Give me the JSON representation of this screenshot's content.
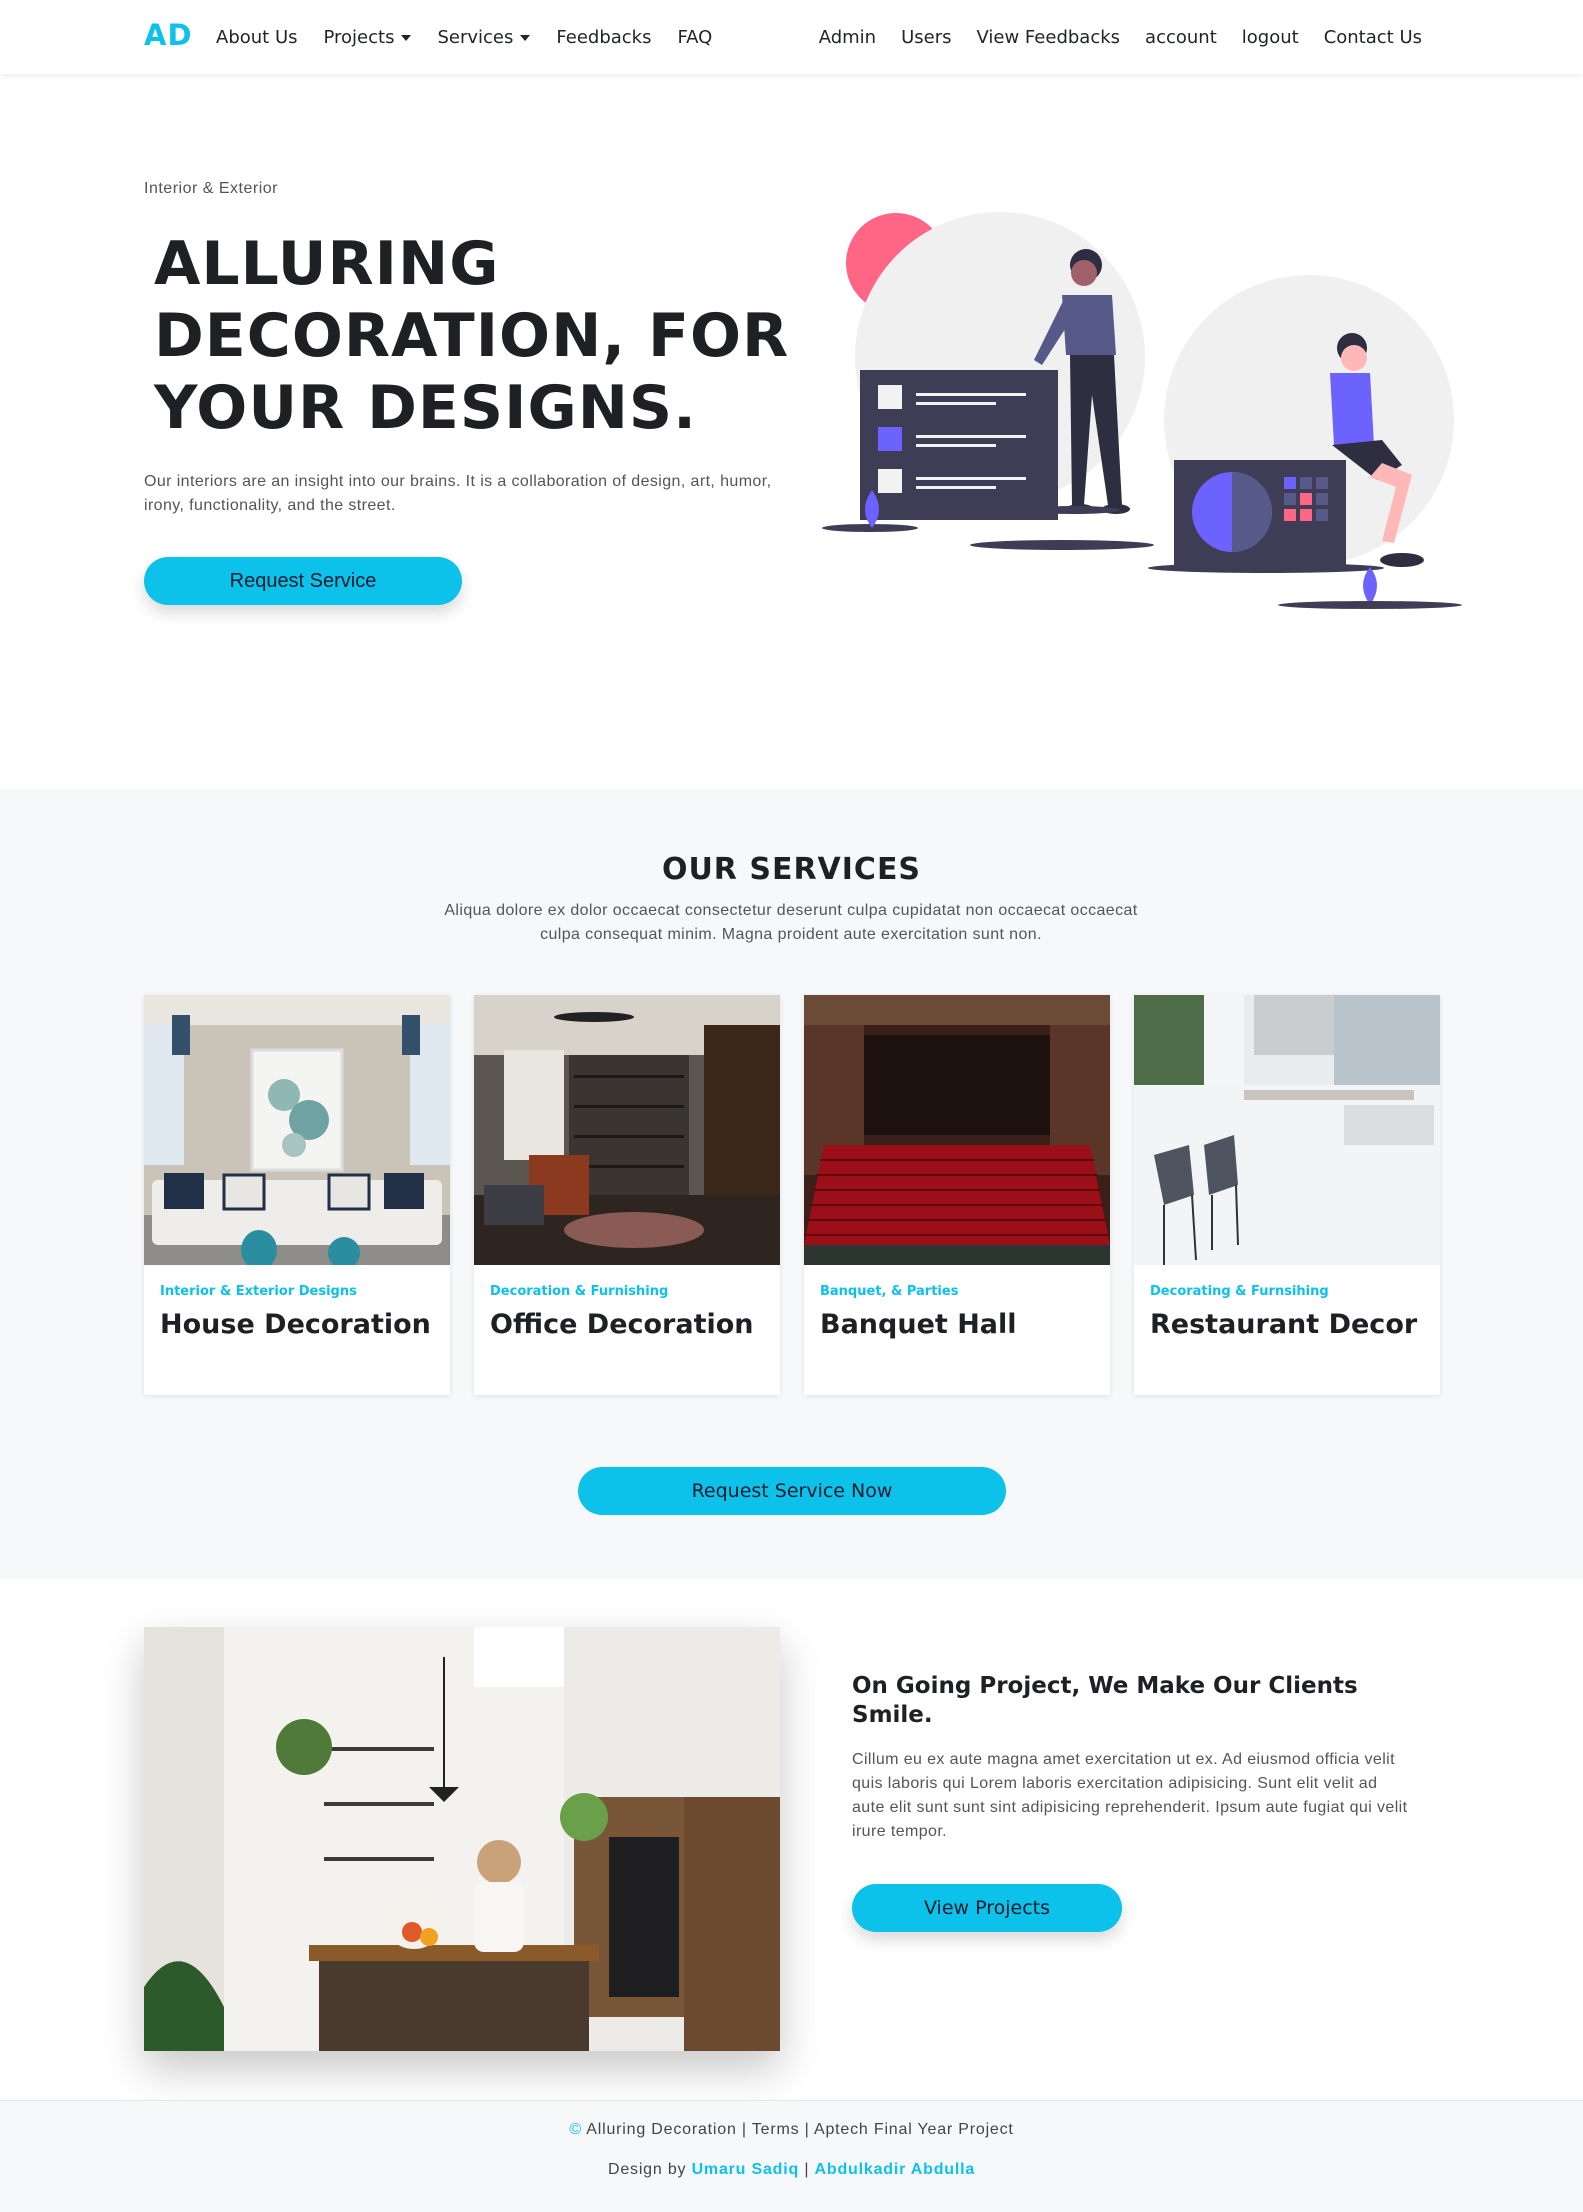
{
  "nav": {
    "brand": "AD",
    "left": [
      {
        "label": "About Us",
        "dropdown": false
      },
      {
        "label": "Projects",
        "dropdown": true
      },
      {
        "label": "Services",
        "dropdown": true
      },
      {
        "label": "Feedbacks",
        "dropdown": false
      },
      {
        "label": "FAQ",
        "dropdown": false
      }
    ],
    "right": [
      "Admin",
      "Users",
      "View Feedbacks",
      "account",
      "logout",
      "Contact Us"
    ]
  },
  "hero": {
    "eyebrow": "Interior & Exterior",
    "title_lines": [
      "ALLURING",
      "DECORATION, FOR",
      "YOUR DESIGNS."
    ],
    "description": "Our interiors are an insight into our brains. It is a collaboration of design, art, humor, irony, functionality, and the street.",
    "button": "Request Service"
  },
  "services": {
    "title": "OUR SERVICES",
    "description": "Aliqua dolore ex dolor occaecat consectetur deserunt culpa cupidatat non occaecat occaecat culpa consequat minim. Magna proident aute exercitation sunt non.",
    "cards": [
      {
        "tag": "Interior & Exterior Designs",
        "title": "House Decoration"
      },
      {
        "tag": "Decoration & Furnishing",
        "title": "Office Decoration"
      },
      {
        "tag": "Banquet, & Parties",
        "title": "Banquet Hall"
      },
      {
        "tag": "Decorating & Furnsihing",
        "title": "Restaurant Decor"
      }
    ],
    "button": "Request Service Now"
  },
  "project": {
    "title": "On Going Project, We Make Our Clients Smile.",
    "description": "Cillum eu ex aute magna amet exercitation ut ex. Ad eiusmod officia velit quis laboris qui Lorem laboris exercitation adipisicing. Sunt elit velit ad aute elit sunt sunt sint adipisicing reprehenderit. Ipsum aute fugiat qui velit irure tempor.",
    "button": "View Projects"
  },
  "footer": {
    "copyright_symbol": "©",
    "site": "Alluring Decoration",
    "terms": "Terms",
    "project_note": "Aptech Final Year Project",
    "design_by": "Design by",
    "author1": "Umaru Sadiq",
    "author2": "Abdulkadir Abdulla",
    "separator": "|"
  },
  "colors": {
    "accent": "#0cc1ea",
    "illustration_purple": "#6c63ff",
    "illustration_pink": "#ff6584",
    "illustration_dark": "#3f3d56"
  }
}
